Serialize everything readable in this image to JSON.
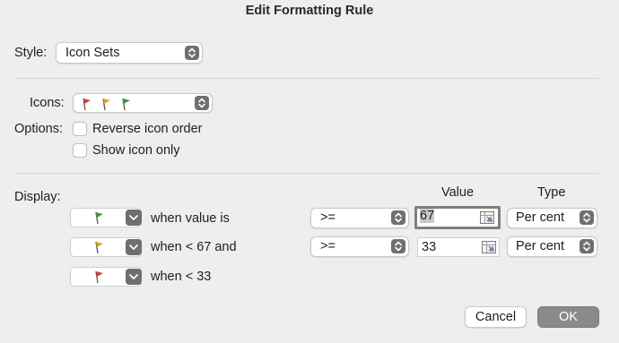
{
  "dialog": {
    "title": "Edit Formatting Rule"
  },
  "style": {
    "label": "Style:",
    "value": "Icon Sets"
  },
  "icons": {
    "label": "Icons:",
    "flags": [
      "red-flag-icon",
      "yellow-flag-icon",
      "green-flag-icon"
    ]
  },
  "options": {
    "label": "Options:",
    "reverse_order": {
      "label": "Reverse icon order",
      "checked": false
    },
    "show_icon_only": {
      "label": "Show icon only",
      "checked": false
    }
  },
  "display": {
    "label": "Display:",
    "columns": {
      "value": "Value",
      "type": "Type"
    },
    "rules": [
      {
        "icon": "green-flag-icon",
        "condition": "when value is",
        "operator": ">=",
        "value": "67",
        "type": "Per cent"
      },
      {
        "icon": "yellow-flag-icon",
        "condition": "when < 67 and",
        "operator": ">=",
        "value": "33",
        "type": "Per cent"
      },
      {
        "icon": "red-flag-icon",
        "condition": "when < 33"
      }
    ]
  },
  "buttons": {
    "cancel": "Cancel",
    "ok": "OK"
  },
  "colors": {
    "flag_red": "#d83a3a",
    "flag_yellow": "#e3a21a",
    "flag_green": "#3d9a3d",
    "ok_button": "#8a8a8a"
  }
}
